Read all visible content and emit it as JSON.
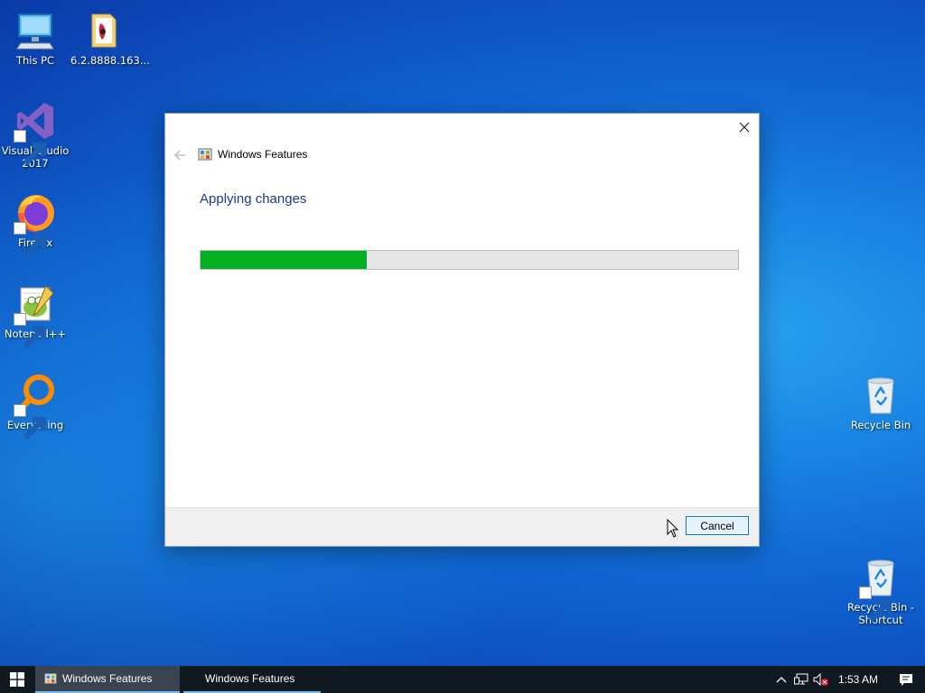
{
  "desktop": {
    "icons_left": [
      {
        "label": "This PC",
        "icon": "computer-icon"
      },
      {
        "label": "6.2.8888.163...",
        "icon": "folder-icon"
      },
      {
        "label": "Visual Studio 2017",
        "icon": "visual-studio-icon"
      },
      {
        "label": "Firefox",
        "icon": "firefox-icon"
      },
      {
        "label": "Notepad++",
        "icon": "notepadpp-icon"
      },
      {
        "label": "Everything",
        "icon": "everything-search-icon"
      }
    ],
    "icons_right": [
      {
        "label": "Recycle Bin",
        "icon": "recycle-bin-icon"
      },
      {
        "label": "Recycle Bin - Shortcut",
        "icon": "recycle-bin-icon"
      }
    ]
  },
  "dialog": {
    "title": "Windows Features",
    "heading": "Applying changes",
    "progress": 0.31,
    "cancel_label": "Cancel"
  },
  "taskbar": {
    "items": [
      {
        "label": "Windows Features",
        "active": true
      },
      {
        "label": "Windows Features",
        "active": false
      }
    ],
    "clock": "1:53 AM"
  },
  "colors": {
    "progress_fill": "#06b025",
    "heading": "#1e3a8a",
    "taskbar": "#101820"
  }
}
